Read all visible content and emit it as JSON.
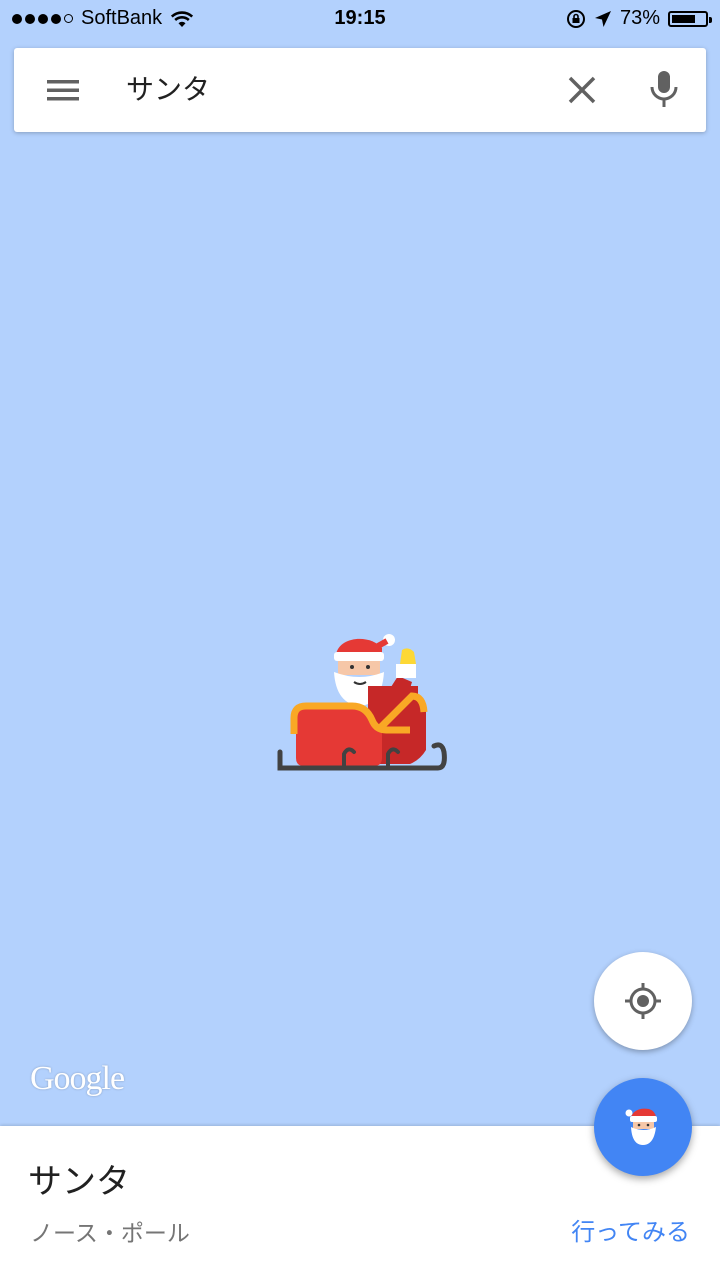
{
  "status_bar": {
    "carrier": "SoftBank",
    "time": "19:15",
    "battery_percent": "73%",
    "battery_level": 0.73
  },
  "search": {
    "query": "サンタ",
    "icons": [
      "menu-icon",
      "close-icon",
      "mic-icon"
    ]
  },
  "map": {
    "background_color": "#b3d1fd",
    "logo_text": "Google",
    "marker_icon": "santa-sleigh-icon"
  },
  "controls": {
    "locate_icon": "my-location-icon",
    "fab_icon": "santa-face-icon",
    "fab_color": "#4285f4"
  },
  "place_card": {
    "title": "サンタ",
    "subtitle": "ノース・ポール",
    "action_label": "行ってみる",
    "action_color": "#4285f4"
  }
}
